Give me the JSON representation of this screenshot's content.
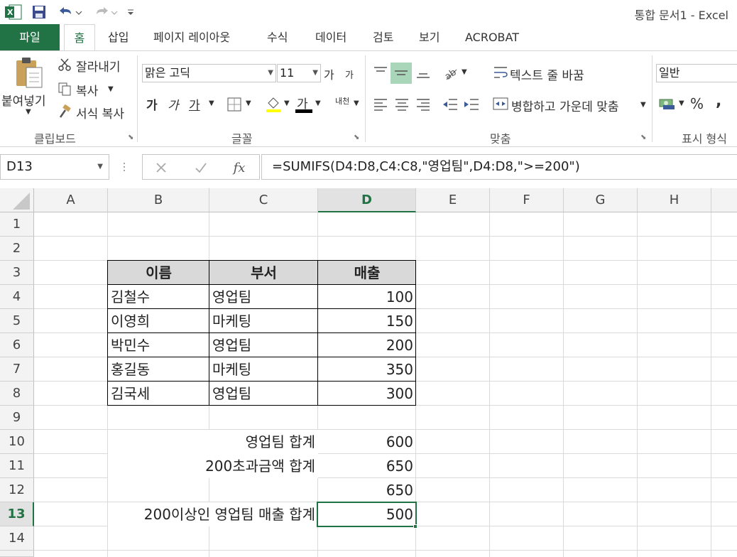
{
  "window": {
    "title": "통합 문서1 - Excel"
  },
  "colors": {
    "accent": "#217346",
    "header_fill": "#d9d9d9"
  },
  "tabs": [
    "파일",
    "홈",
    "삽입",
    "페이지 레이아웃",
    "수식",
    "데이터",
    "검토",
    "보기",
    "ACROBAT"
  ],
  "ribbon": {
    "clipboard": {
      "paste": "붙여넣기",
      "cut": "잘라내기",
      "copy": "복사",
      "format_painter": "서식 복사",
      "label": "클립보드"
    },
    "font": {
      "font_name": "맑은 고딕",
      "font_size": "11",
      "grow": "가",
      "shrink": "가",
      "bold": "가",
      "italic": "가",
      "underline": "가",
      "font_color_glyph": "가",
      "phonetic": "내천",
      "label": "글꼴"
    },
    "alignment": {
      "wrap_text": "텍스트 줄 바꿈",
      "merge_center": "병합하고 가운데 맞춤",
      "label": "맞춤"
    },
    "number": {
      "format": "일반",
      "percent": "%",
      "comma": ",",
      "label": "표시 형식"
    }
  },
  "formula_bar": {
    "name_box": "D13",
    "formula": "=SUMIFS(D4:D8,C4:C8,\"영업팀\",D4:D8,\">=200\")"
  },
  "sheet": {
    "columns": [
      "A",
      "B",
      "C",
      "D",
      "E",
      "F",
      "G",
      "H"
    ],
    "rows": [
      "1",
      "2",
      "3",
      "4",
      "5",
      "6",
      "7",
      "8",
      "9",
      "10",
      "11",
      "12",
      "13",
      "14"
    ],
    "selected_column": "D",
    "selected_row": "13",
    "table_header": {
      "name": "이름",
      "dept": "부서",
      "sales": "매출"
    },
    "table_rows": [
      {
        "name": "김철수",
        "dept": "영업팀",
        "sales": "100"
      },
      {
        "name": "이영희",
        "dept": "마케팅",
        "sales": "150"
      },
      {
        "name": "박민수",
        "dept": "영업팀",
        "sales": "200"
      },
      {
        "name": "홍길동",
        "dept": "마케팅",
        "sales": "350"
      },
      {
        "name": "김국세",
        "dept": "영업팀",
        "sales": "300"
      }
    ],
    "summary": [
      {
        "label": "영업팀 합계",
        "value": "600"
      },
      {
        "label": "200초과금액 합계",
        "value": "650"
      },
      {
        "label": "",
        "value": "650"
      },
      {
        "label": "200이상인 영업팀 매출 합계",
        "value": "500"
      }
    ]
  }
}
